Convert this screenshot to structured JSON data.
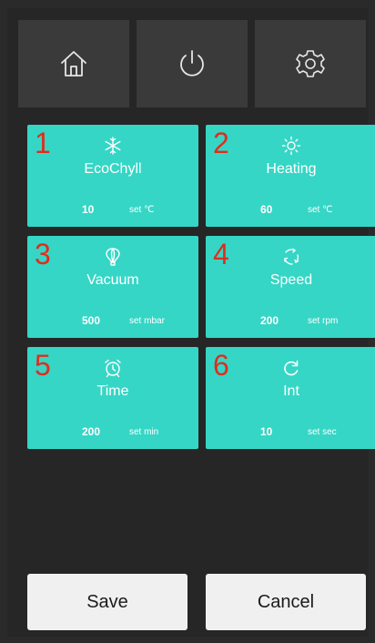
{
  "topbar": {
    "buttons": [
      {
        "icon": "home-icon"
      },
      {
        "icon": "power-icon"
      },
      {
        "icon": "gear-icon"
      }
    ]
  },
  "tiles": [
    {
      "number": "1",
      "icon": "snowflake-icon",
      "name": "EcoChyll",
      "value": "10",
      "unit": "set ℃"
    },
    {
      "number": "2",
      "icon": "sun-icon",
      "name": "Heating",
      "value": "60",
      "unit": "set ℃"
    },
    {
      "number": "3",
      "icon": "vacuum-icon",
      "name": "Vacuum",
      "value": "500",
      "unit": "set mbar"
    },
    {
      "number": "4",
      "icon": "rotation-icon",
      "name": "Speed",
      "value": "200",
      "unit": "set rpm"
    },
    {
      "number": "5",
      "icon": "alarm-clock-icon",
      "name": "Time",
      "value": "200",
      "unit": "set min"
    },
    {
      "number": "6",
      "icon": "refresh-icon",
      "name": "Int",
      "value": "10",
      "unit": "set sec"
    }
  ],
  "actions": {
    "save": "Save",
    "cancel": "Cancel"
  },
  "colors": {
    "tile": "#35d6c5",
    "number": "#e02d1e",
    "background": "#262626",
    "topbar_button": "#3a3a3a",
    "action_button": "#f0f0f0"
  }
}
